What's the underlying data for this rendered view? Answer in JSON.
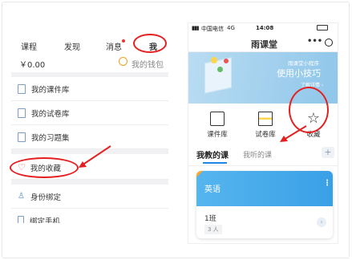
{
  "left": {
    "tabs": [
      {
        "label": "课程"
      },
      {
        "label": "发现"
      },
      {
        "label": "消息"
      },
      {
        "label": "我"
      }
    ],
    "wallet": {
      "amount": "￥0.00",
      "label": "我的钱包"
    },
    "menu": [
      {
        "label": "我的课件库"
      },
      {
        "label": "我的试卷库"
      },
      {
        "label": "我的习题集"
      },
      {
        "label": "我的收藏"
      },
      {
        "label": "身份绑定"
      },
      {
        "label": "绑定手机"
      }
    ]
  },
  "right": {
    "status": {
      "carrier": "中国电信",
      "network": "4G",
      "time": "14:08"
    },
    "title": "雨课堂",
    "banner": {
      "small": "雨课堂小程序",
      "big": "使用小技巧",
      "link": "了解详情 ›"
    },
    "quick": [
      {
        "label": "课件库"
      },
      {
        "label": "试卷库"
      },
      {
        "label": "收藏"
      }
    ],
    "tabs": [
      {
        "label": "我教的课"
      },
      {
        "label": "我听的课"
      }
    ],
    "add": "+",
    "course": {
      "name": "英语",
      "class_name": "1班",
      "count": "3 人"
    }
  },
  "colors": {
    "accent": "#1e88e5",
    "highlight": "#e51f1f"
  }
}
